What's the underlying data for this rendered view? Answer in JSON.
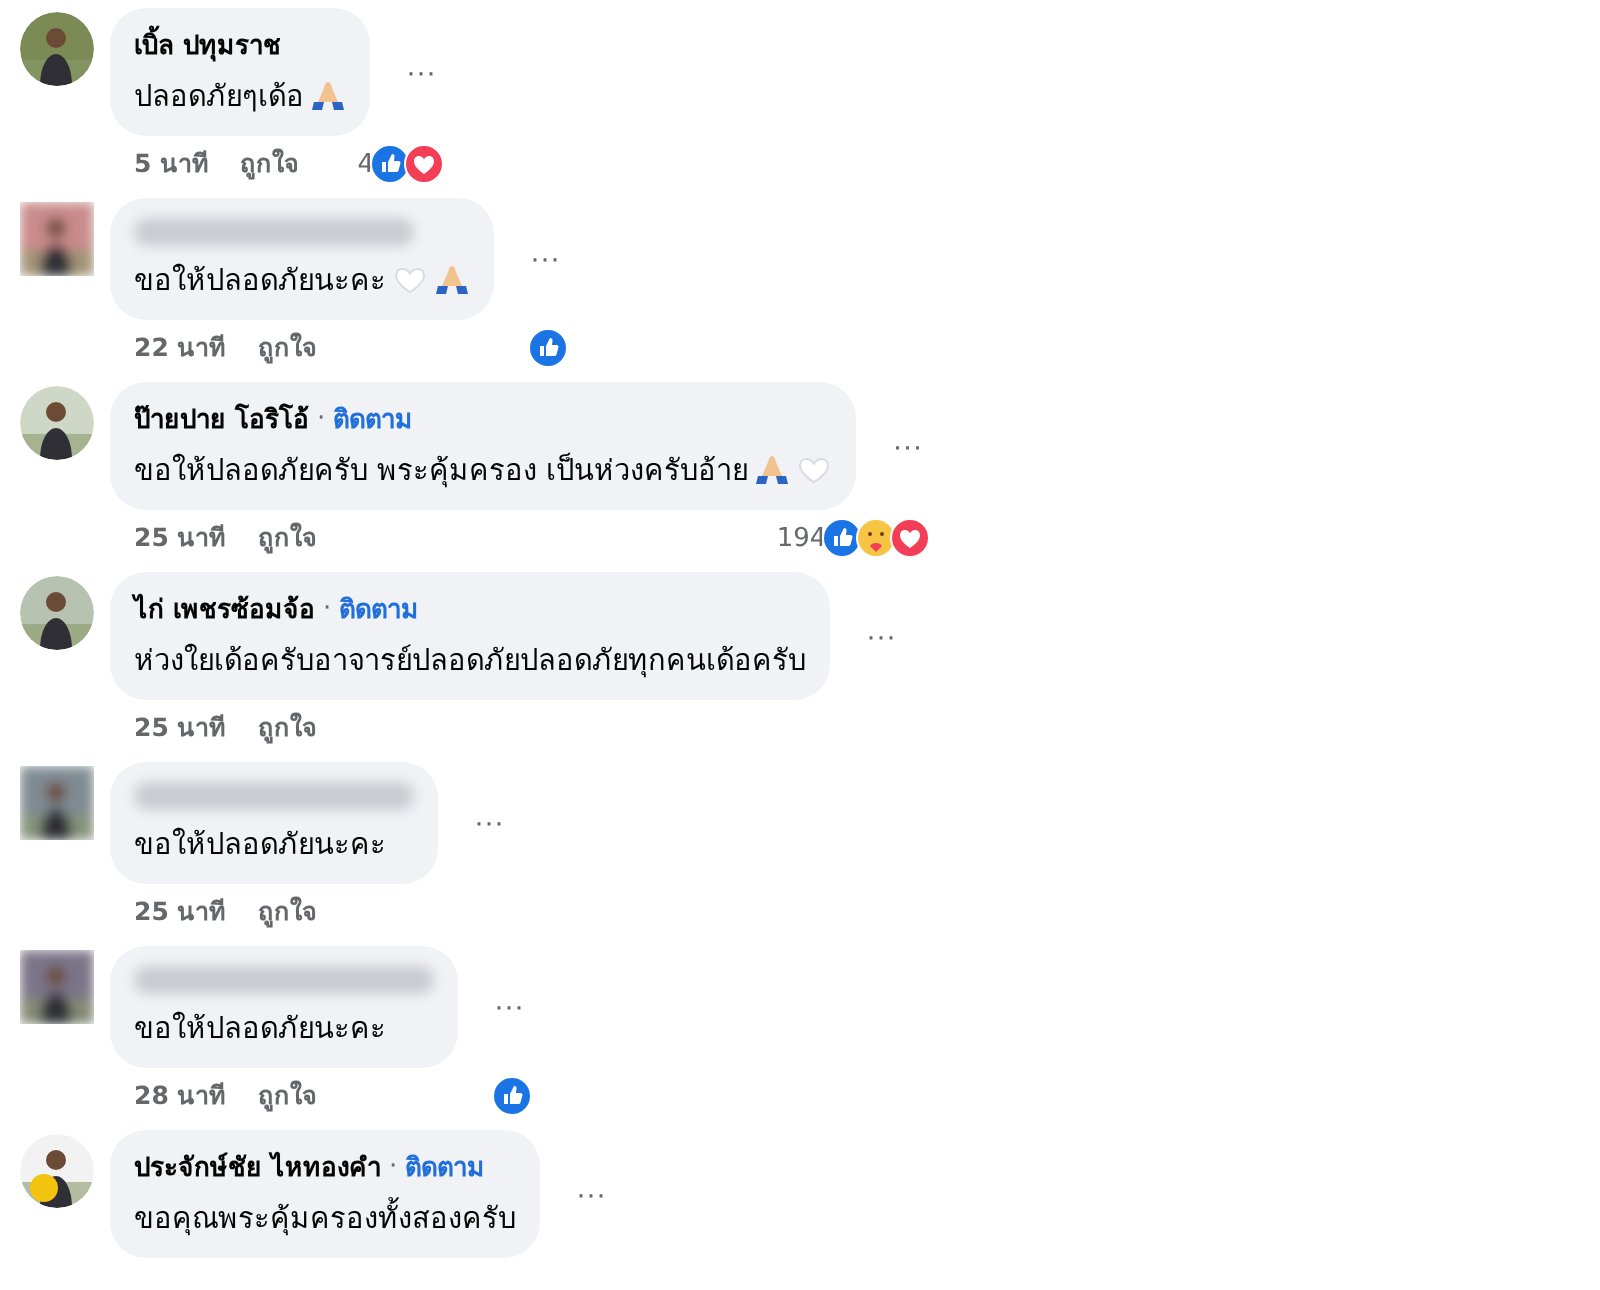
{
  "comments": [
    {
      "name": "เบิ้ล ปทุมราช",
      "name_blurred": false,
      "text": "ปลอดภัยๆเด้อ",
      "emoji": [
        {
          "kind": "pray"
        }
      ],
      "more": "···",
      "time": "5 นาที",
      "like_label": "ถูกใจ",
      "reaction_count": "4",
      "reactions": [
        {
          "kind": "like"
        },
        {
          "kind": "love"
        }
      ],
      "avatar_blurred": false
    },
    {
      "name_blurred": true,
      "text": "ขอให้ปลอดภัยนะคะ",
      "emoji": [
        {
          "kind": "heart"
        },
        {
          "kind": "pray"
        }
      ],
      "more": "···",
      "time": "22 นาที",
      "like_label": "ถูกใจ",
      "reactions": [
        {
          "kind": "like"
        }
      ],
      "avatar_blurred": true
    },
    {
      "name": "ป๊ายปาย โอริโอ้",
      "name_blurred": false,
      "separator": "·",
      "follow": "ติดตาม",
      "text": "ขอให้ปลอดภัยครับ พระคุ้มครอง เป็นห่วงครับอ้าย",
      "emoji": [
        {
          "kind": "pray"
        },
        {
          "kind": "heart"
        }
      ],
      "more": "···",
      "time": "25 นาที",
      "like_label": "ถูกใจ",
      "reaction_count": "194",
      "reactions": [
        {
          "kind": "like"
        },
        {
          "kind": "care"
        },
        {
          "kind": "love"
        }
      ],
      "avatar_blurred": false
    },
    {
      "name": "ไก่ เพชรซ้อมจ้อ",
      "name_blurred": false,
      "separator": "·",
      "follow": "ติดตาม",
      "text": "ห่วงใยเด้อครับอาจารย์ปลอดภัยปลอดภัยทุกคนเด้อครับ",
      "more": "···",
      "time": "25 นาที",
      "like_label": "ถูกใจ",
      "avatar_blurred": false
    },
    {
      "name_blurred": true,
      "text": "ขอให้ปลอดภัยนะคะ",
      "more": "···",
      "time": "25 นาที",
      "like_label": "ถูกใจ",
      "avatar_blurred": true
    },
    {
      "name_blurred": true,
      "text": "ขอให้ปลอดภัยนะคะ",
      "more": "···",
      "time": "28 นาที",
      "like_label": "ถูกใจ",
      "reactions": [
        {
          "kind": "like"
        }
      ],
      "avatar_blurred": true
    },
    {
      "name": "ประจักษ์ชัย ไหทองคำ",
      "name_blurred": false,
      "separator": "·",
      "follow": "ติดตาม",
      "text": "ขอคุณพระคุ้มครองทั้งสองครับ",
      "more": "···",
      "avatar_blurred": false
    }
  ]
}
